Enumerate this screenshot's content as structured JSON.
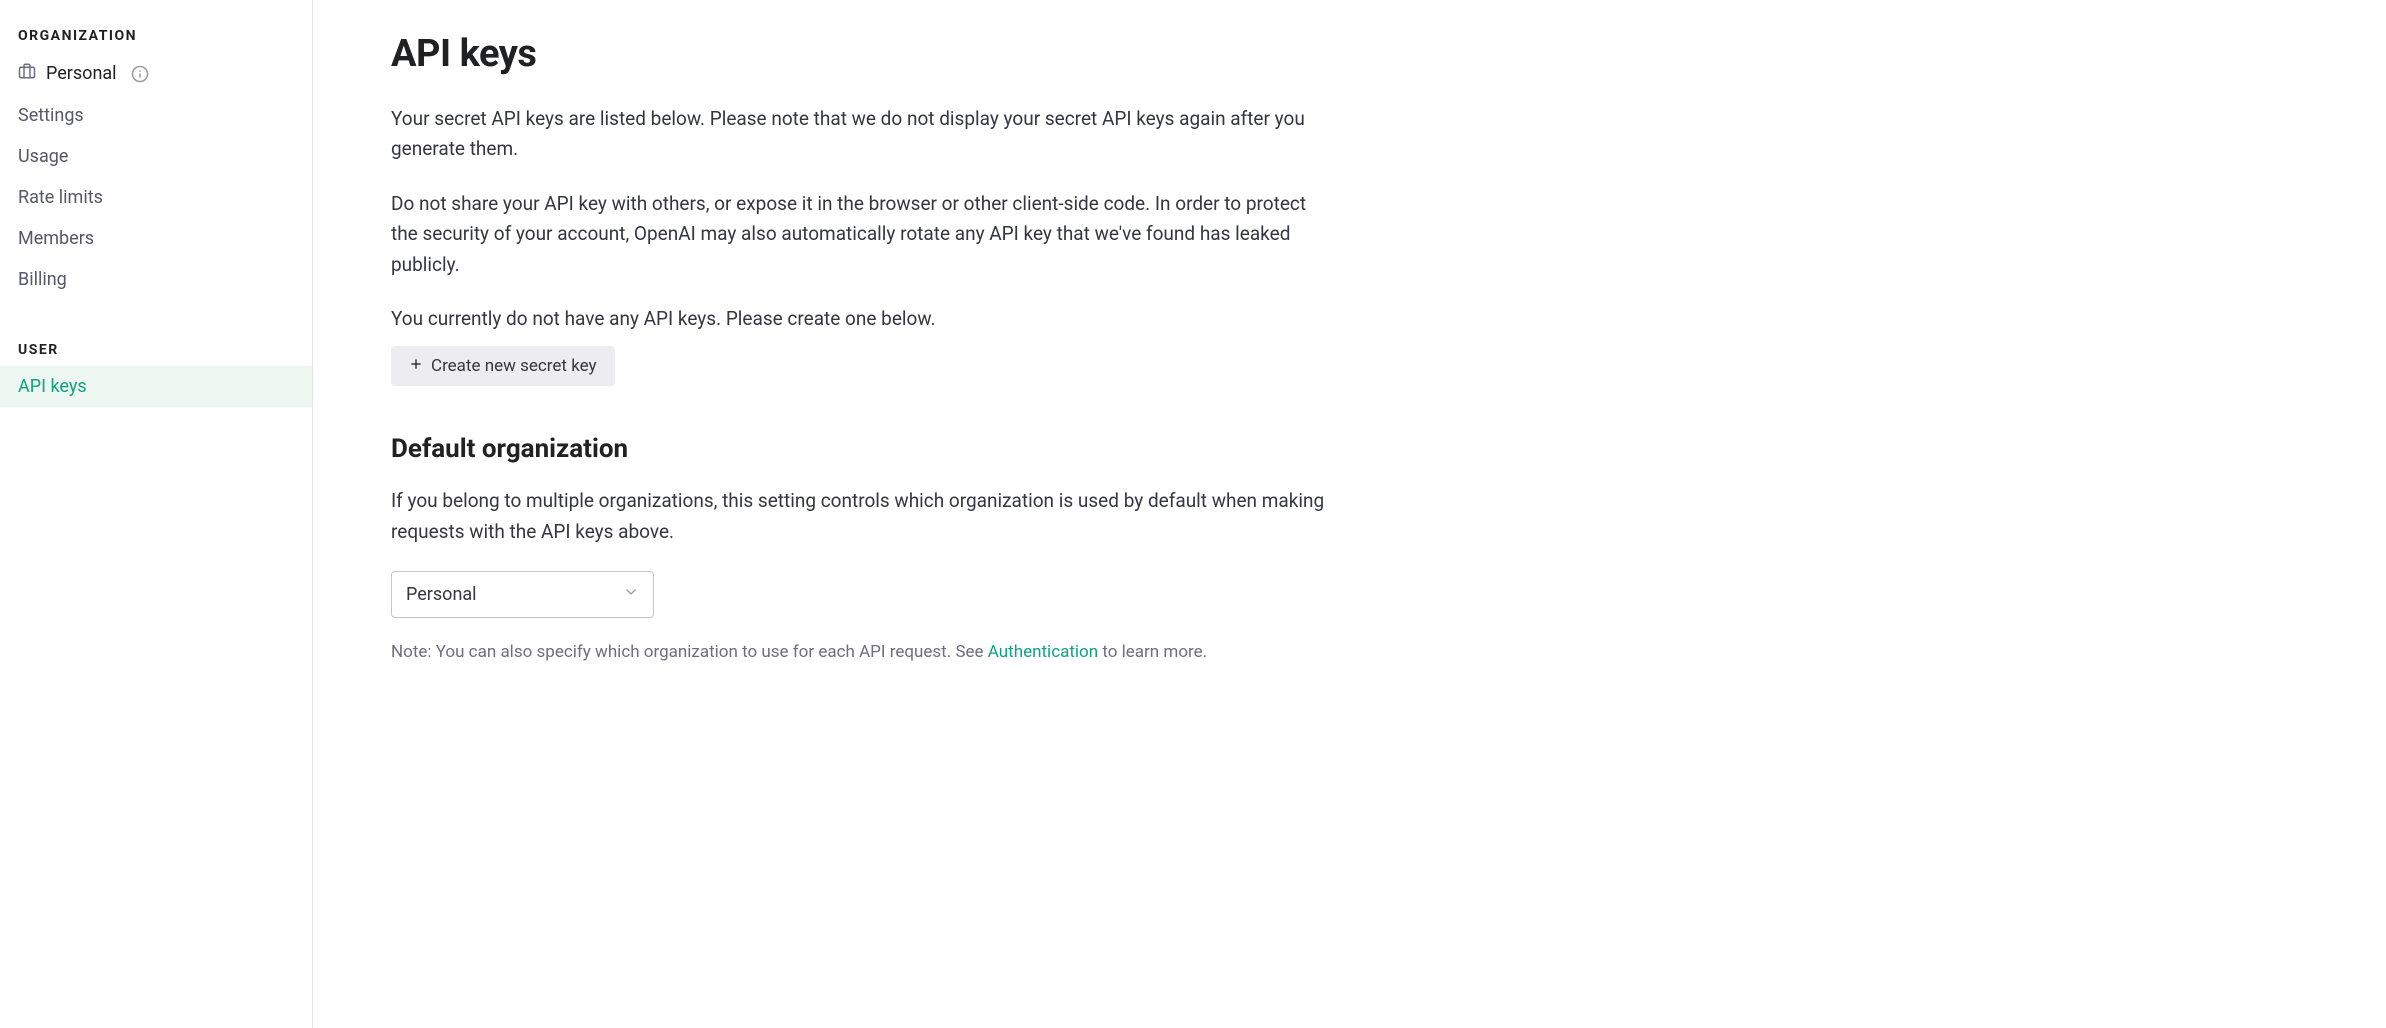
{
  "sidebar": {
    "org_section_label": "ORGANIZATION",
    "org_name": "Personal",
    "items": [
      {
        "label": "Settings"
      },
      {
        "label": "Usage"
      },
      {
        "label": "Rate limits"
      },
      {
        "label": "Members"
      },
      {
        "label": "Billing"
      }
    ],
    "user_section_label": "USER",
    "user_items": [
      {
        "label": "API keys"
      }
    ]
  },
  "main": {
    "title": "API keys",
    "intro1": "Your secret API keys are listed below. Please note that we do not display your secret API keys again after you generate them.",
    "intro2": "Do not share your API key with others, or expose it in the browser or other client-side code. In order to protect the security of your account, OpenAI may also automatically rotate any API key that we've found has leaked publicly.",
    "empty_state": "You currently do not have any API keys. Please create one below.",
    "create_button_label": "Create new secret key",
    "default_org_title": "Default organization",
    "default_org_desc": "If you belong to multiple organizations, this setting controls which organization is used by default when making requests with the API keys above.",
    "org_select_value": "Personal",
    "note_prefix": "Note: You can also specify which organization to use for each API request. See ",
    "note_link": "Authentication",
    "note_suffix": " to learn more."
  }
}
